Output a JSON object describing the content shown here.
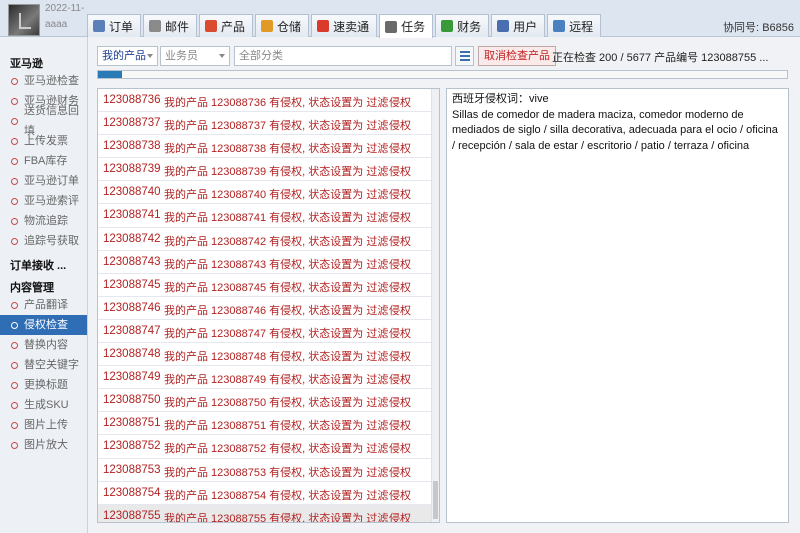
{
  "header": {
    "date": "2022-11-16",
    "user": "aaaa",
    "right_label": "协同号:",
    "right_value": "B6856",
    "tabs": [
      {
        "label": "订单",
        "icon": "order-icon",
        "color": "#5b7fb8"
      },
      {
        "label": "邮件",
        "icon": "mail-icon",
        "color": "#8a8a8a"
      },
      {
        "label": "产品",
        "icon": "product-icon",
        "color": "#d94c2f"
      },
      {
        "label": "仓储",
        "icon": "warehouse-icon",
        "color": "#e09a25"
      },
      {
        "label": "速卖通",
        "icon": "aliexpress-icon",
        "color": "#d93a2b"
      },
      {
        "label": "任务",
        "icon": "task-icon",
        "color": "#6a6a6a"
      },
      {
        "label": "财务",
        "icon": "finance-icon",
        "color": "#3a9a3a"
      },
      {
        "label": "用户",
        "icon": "user-icon",
        "color": "#4a6fb0"
      },
      {
        "label": "远程",
        "icon": "remote-icon",
        "color": "#4a7fc0"
      }
    ],
    "active_tab": "任务"
  },
  "sidebar": {
    "group1": "亚马逊",
    "items1": [
      "亚马逊检查",
      "亚马逊财务",
      "送货信息回填",
      "上传发票",
      "FBA库存",
      "亚马逊订单",
      "亚马逊索评",
      "物流追踪",
      "追踪号获取"
    ],
    "group2": "订单接收 ...",
    "group3": "内容管理",
    "items3": [
      "产品翻译",
      "侵权检查",
      "替换内容",
      "替空关键字",
      "更换标题",
      "生成SKU",
      "图片上传",
      "图片放大"
    ],
    "active_item": "侵权检查"
  },
  "toolbar": {
    "product_select": "我的产品",
    "salesperson_placeholder": "业务员",
    "category_placeholder": "全部分类",
    "cancel_button": "取消检查产品",
    "status_text": "正在检查 200 / 5677  产品编号 123088755 ..."
  },
  "progress": {
    "fraction": 0.035
  },
  "list": {
    "rows": [
      {
        "id": "123088736",
        "msg": "我的产品 123088736 有侵权, 状态设置为 过滤",
        "tag": "侵权"
      },
      {
        "id": "123088737",
        "msg": "我的产品 123088737 有侵权, 状态设置为 过滤",
        "tag": "侵权"
      },
      {
        "id": "123088738",
        "msg": "我的产品 123088738 有侵权, 状态设置为 过滤",
        "tag": "侵权"
      },
      {
        "id": "123088739",
        "msg": "我的产品 123088739 有侵权, 状态设置为 过滤",
        "tag": "侵权"
      },
      {
        "id": "123088740",
        "msg": "我的产品 123088740 有侵权, 状态设置为 过滤",
        "tag": "侵权"
      },
      {
        "id": "123088741",
        "msg": "我的产品 123088741 有侵权, 状态设置为 过滤",
        "tag": "侵权"
      },
      {
        "id": "123088742",
        "msg": "我的产品 123088742 有侵权, 状态设置为 过滤",
        "tag": "侵权"
      },
      {
        "id": "123088743",
        "msg": "我的产品 123088743 有侵权, 状态设置为 过滤",
        "tag": "侵权"
      },
      {
        "id": "123088745",
        "msg": "我的产品 123088745 有侵权, 状态设置为 过滤",
        "tag": "侵权"
      },
      {
        "id": "123088746",
        "msg": "我的产品 123088746 有侵权, 状态设置为 过滤",
        "tag": "侵权"
      },
      {
        "id": "123088747",
        "msg": "我的产品 123088747 有侵权, 状态设置为 过滤",
        "tag": "侵权"
      },
      {
        "id": "123088748",
        "msg": "我的产品 123088748 有侵权, 状态设置为 过滤",
        "tag": "侵权"
      },
      {
        "id": "123088749",
        "msg": "我的产品 123088749 有侵权, 状态设置为 过滤",
        "tag": "侵权"
      },
      {
        "id": "123088750",
        "msg": "我的产品 123088750 有侵权, 状态设置为 过滤",
        "tag": "侵权"
      },
      {
        "id": "123088751",
        "msg": "我的产品 123088751 有侵权, 状态设置为 过滤",
        "tag": "侵权"
      },
      {
        "id": "123088752",
        "msg": "我的产品 123088752 有侵权, 状态设置为 过滤",
        "tag": "侵权"
      },
      {
        "id": "123088753",
        "msg": "我的产品 123088753 有侵权, 状态设置为 过滤",
        "tag": "侵权"
      },
      {
        "id": "123088754",
        "msg": "我的产品 123088754 有侵权, 状态设置为 过滤",
        "tag": "侵权"
      },
      {
        "id": "123088755",
        "msg": "我的产品 123088755 有侵权, 状态设置为 过滤",
        "tag": "侵权"
      }
    ]
  },
  "detail": {
    "title": "西班牙侵权词：vive",
    "body": "Sillas de comedor de madera maciza, comedor moderno de mediados de siglo / silla decorativa, adecuada para el ocio / oficina / recepción / sala de estar / escritorio / patio / terraza / oficina"
  }
}
